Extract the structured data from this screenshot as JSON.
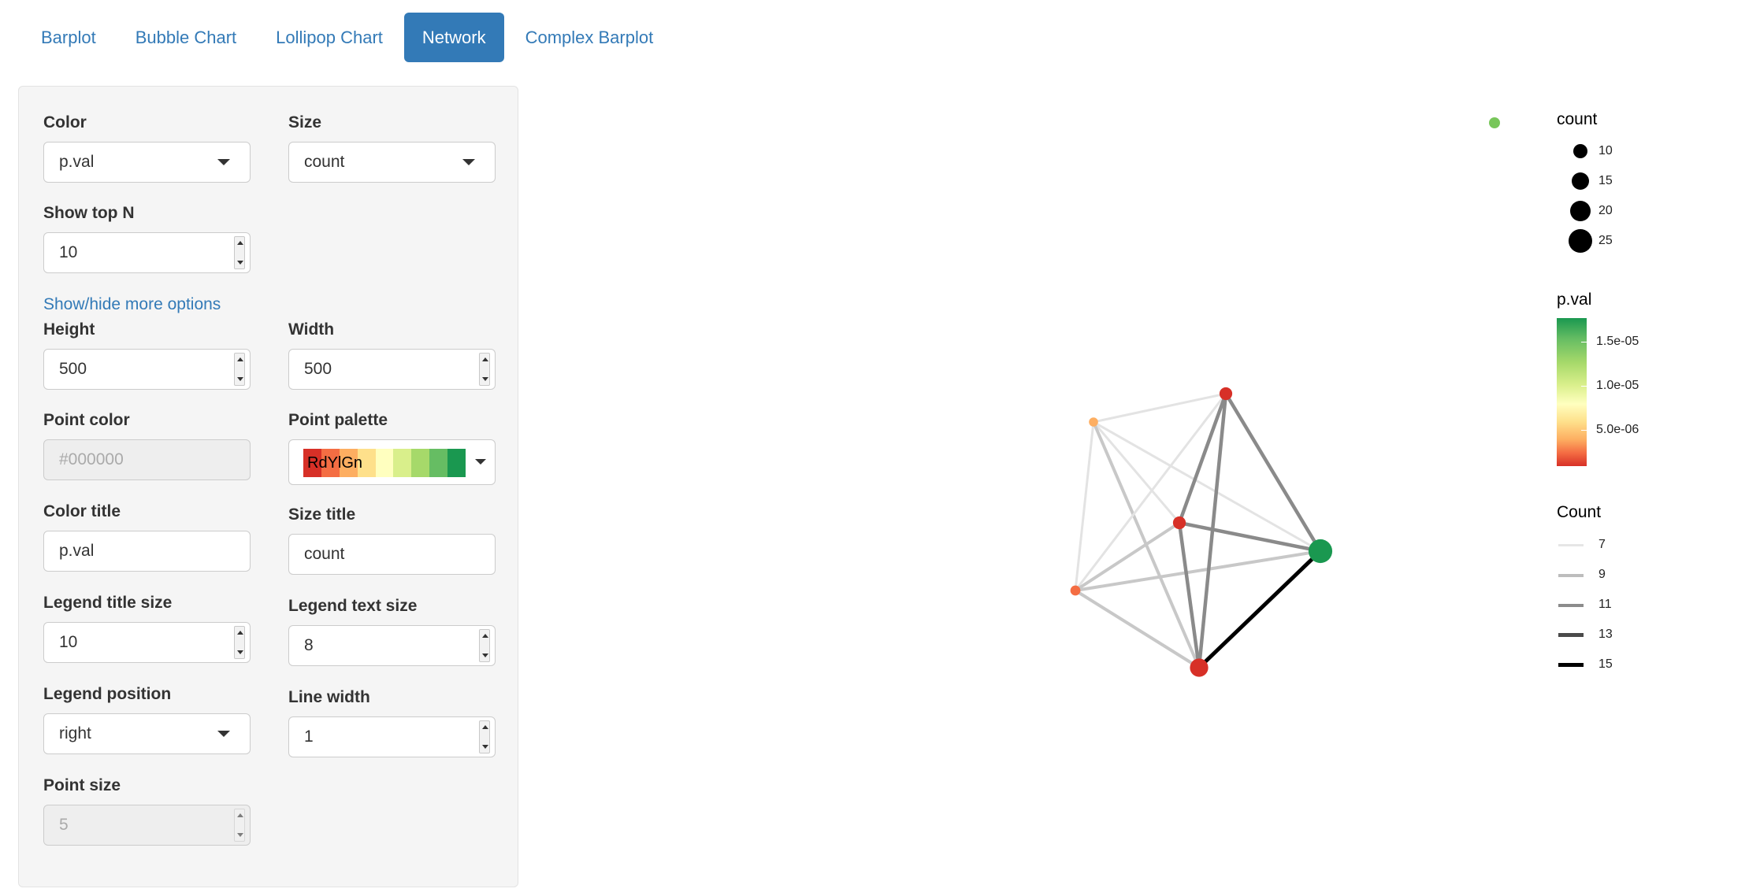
{
  "tabs": [
    {
      "label": "Barplot",
      "active": false
    },
    {
      "label": "Bubble Chart",
      "active": false
    },
    {
      "label": "Lollipop Chart",
      "active": false
    },
    {
      "label": "Network",
      "active": true
    },
    {
      "label": "Complex Barplot",
      "active": false
    }
  ],
  "panel": {
    "color": {
      "label": "Color",
      "value": "p.val"
    },
    "size": {
      "label": "Size",
      "value": "count"
    },
    "show_top_n": {
      "label": "Show top N",
      "value": "10"
    },
    "toggle_link": "Show/hide more options",
    "height": {
      "label": "Height",
      "value": "500"
    },
    "width": {
      "label": "Width",
      "value": "500"
    },
    "point_color": {
      "label": "Point color",
      "placeholder": "#000000"
    },
    "point_palette": {
      "label": "Point palette",
      "value": "RdYlGn",
      "swatches": [
        "#d73027",
        "#f46d43",
        "#fdae61",
        "#fee08b",
        "#ffffbf",
        "#d9ef8b",
        "#a6d96a",
        "#66bd63",
        "#1a9850"
      ]
    },
    "color_title": {
      "label": "Color title",
      "value": "p.val"
    },
    "size_title": {
      "label": "Size title",
      "value": "count"
    },
    "legend_title_size": {
      "label": "Legend title size",
      "value": "10"
    },
    "legend_text_size": {
      "label": "Legend text size",
      "value": "8"
    },
    "legend_position": {
      "label": "Legend position",
      "value": "right"
    },
    "line_width": {
      "label": "Line width",
      "value": "1"
    },
    "point_size": {
      "label": "Point size",
      "value": "5"
    }
  },
  "legend": {
    "size": {
      "title": "count",
      "labels": [
        "10",
        "15",
        "20",
        "25"
      ]
    },
    "color": {
      "title": "p.val",
      "labels": [
        "1.5e-05",
        "1.0e-05",
        "5.0e-06"
      ]
    },
    "edges": {
      "title": "Count",
      "labels": [
        "7",
        "9",
        "11",
        "13",
        "15"
      ]
    }
  },
  "network": {
    "nodes": [
      {
        "id": "n1",
        "size_value": 10,
        "color": "#fdae61"
      },
      {
        "id": "n2",
        "size_value": 14,
        "color": "#d73027"
      },
      {
        "id": "n3",
        "size_value": 14,
        "color": "#d73027"
      },
      {
        "id": "n4",
        "size_value": 11,
        "color": "#f46d43"
      },
      {
        "id": "n5",
        "size_value": 26,
        "color": "#1a9850"
      },
      {
        "id": "n6",
        "size_value": 20,
        "color": "#d73027"
      }
    ],
    "edges": [
      {
        "source": "n1",
        "target": "n2",
        "count": 7
      },
      {
        "source": "n1",
        "target": "n3",
        "count": 7
      },
      {
        "source": "n1",
        "target": "n4",
        "count": 7
      },
      {
        "source": "n1",
        "target": "n5",
        "count": 7
      },
      {
        "source": "n1",
        "target": "n6",
        "count": 8
      },
      {
        "source": "n2",
        "target": "n4",
        "count": 7
      },
      {
        "source": "n4",
        "target": "n3",
        "count": 8
      },
      {
        "source": "n4",
        "target": "n5",
        "count": 9
      },
      {
        "source": "n4",
        "target": "n6",
        "count": 9
      },
      {
        "source": "n2",
        "target": "n3",
        "count": 11
      },
      {
        "source": "n2",
        "target": "n6",
        "count": 11
      },
      {
        "source": "n2",
        "target": "n5",
        "count": 11
      },
      {
        "source": "n3",
        "target": "n6",
        "count": 11
      },
      {
        "source": "n3",
        "target": "n5",
        "count": 11
      },
      {
        "source": "n5",
        "target": "n6",
        "count": 15
      }
    ]
  }
}
